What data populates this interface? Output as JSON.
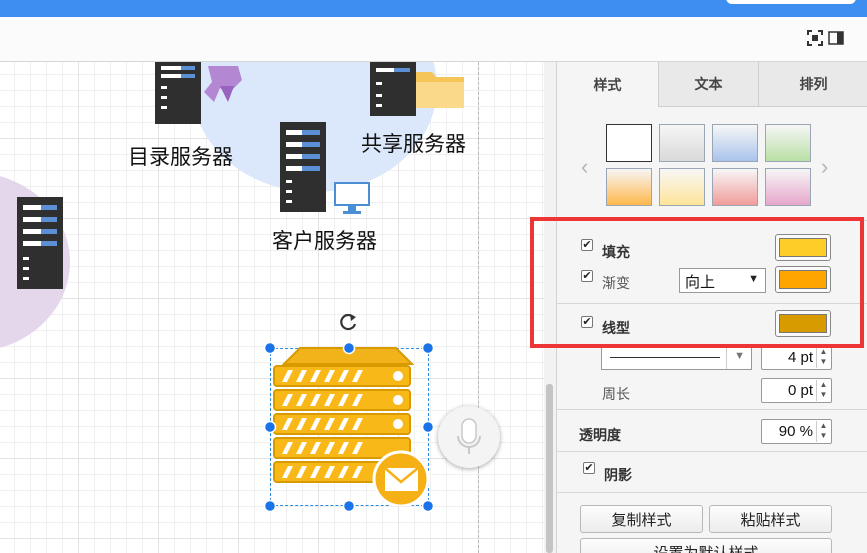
{
  "canvas": {
    "labels": {
      "directory_server": "目录服务器",
      "shared_server": "共享服务器",
      "client_server": "客户服务器"
    }
  },
  "panel": {
    "tabs": [
      {
        "label": "样式",
        "active": true
      },
      {
        "label": "文本",
        "active": false
      },
      {
        "label": "排列",
        "active": false
      }
    ],
    "style_swatches": [
      "#ffffff",
      "#d9d9d9",
      "#a9c4eb",
      "#b9e0a5",
      "#ffb84d",
      "#ffe599",
      "#f19c99",
      "#e6a6cc"
    ],
    "fill": {
      "label": "填充",
      "checked": true,
      "color": "#ffcd28"
    },
    "gradient": {
      "label": "渐变",
      "checked": true,
      "direction": "向上",
      "color": "#ffa500"
    },
    "line": {
      "label": "线型",
      "checked": true,
      "color": "#d79b00"
    },
    "line_width": "4 pt",
    "perimeter": {
      "label": "周长",
      "value": "0 pt"
    },
    "opacity": {
      "label": "透明度",
      "value": "90 %"
    },
    "shadow": {
      "label": "阴影",
      "checked": true
    },
    "buttons": {
      "copy_style": "复制样式",
      "paste_style": "粘贴样式",
      "set_default": "设置为默认样式"
    }
  },
  "colors": {
    "highlight": "#ee3535",
    "titlebar": "#3d8ef0",
    "selection": "#1a73e8"
  }
}
